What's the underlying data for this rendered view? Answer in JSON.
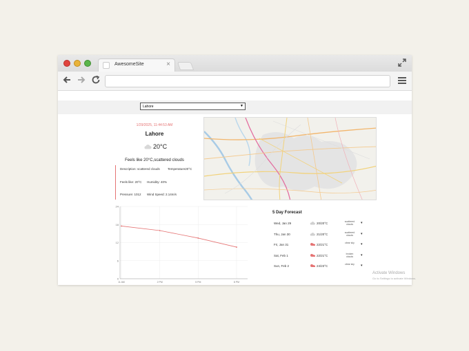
{
  "browser": {
    "tab_title": "AwesomeSite",
    "tab_close": "×",
    "url": ""
  },
  "page": {
    "city_select": {
      "value": "Lahore"
    },
    "datetime": "1/29/2025, 11:44:53 AM",
    "city": "Lahore",
    "temperature": "20°C",
    "feels_like": "Feels like 20°C,scattered clouds",
    "details": {
      "description": "Description: scattered clouds",
      "temperature": "Temperature20°C",
      "feels": "Feels like: 20°C",
      "humidity": "Humidity: 40%",
      "pressure": "Pressure: 1012",
      "wind": "Wind Speed: 2.14m/s"
    }
  },
  "forecast": {
    "title": "5 Day Forecast",
    "days": [
      {
        "day": "Wed, Jan 29",
        "temp": "20/20°C",
        "desc": "scattered clouds",
        "icon": "cloud-icon"
      },
      {
        "day": "Thu, Jan 30",
        "temp": "21/20°C",
        "desc": "scattered clouds",
        "icon": "cloud-icon"
      },
      {
        "day": "Fri, Jan 31",
        "temp": "22/21°C",
        "desc": "clear sky",
        "icon": "sun-icon"
      },
      {
        "day": "Sat, Feb 1",
        "temp": "22/21°C",
        "desc": "broken clouds",
        "icon": "sun-icon"
      },
      {
        "day": "Sun, Feb 2",
        "temp": "24/23°C",
        "desc": "clear sky",
        "icon": "sun-icon"
      }
    ]
  },
  "chart_data": {
    "type": "line",
    "x": [
      "11 AM",
      "2 PM",
      "5 PM",
      "8 PM"
    ],
    "values": [
      17.5,
      16,
      13.5,
      10.5
    ],
    "yticks": [
      "0",
      "6",
      "12",
      "18",
      "24"
    ],
    "ylim": [
      0,
      24
    ],
    "grid": true,
    "color": "#e57373"
  },
  "watermark": {
    "line1": "Activate Windows",
    "line2": "Go to Settings to activate Windows."
  },
  "colors": {
    "accent": "#e57373",
    "background": "#f3f1ea"
  }
}
